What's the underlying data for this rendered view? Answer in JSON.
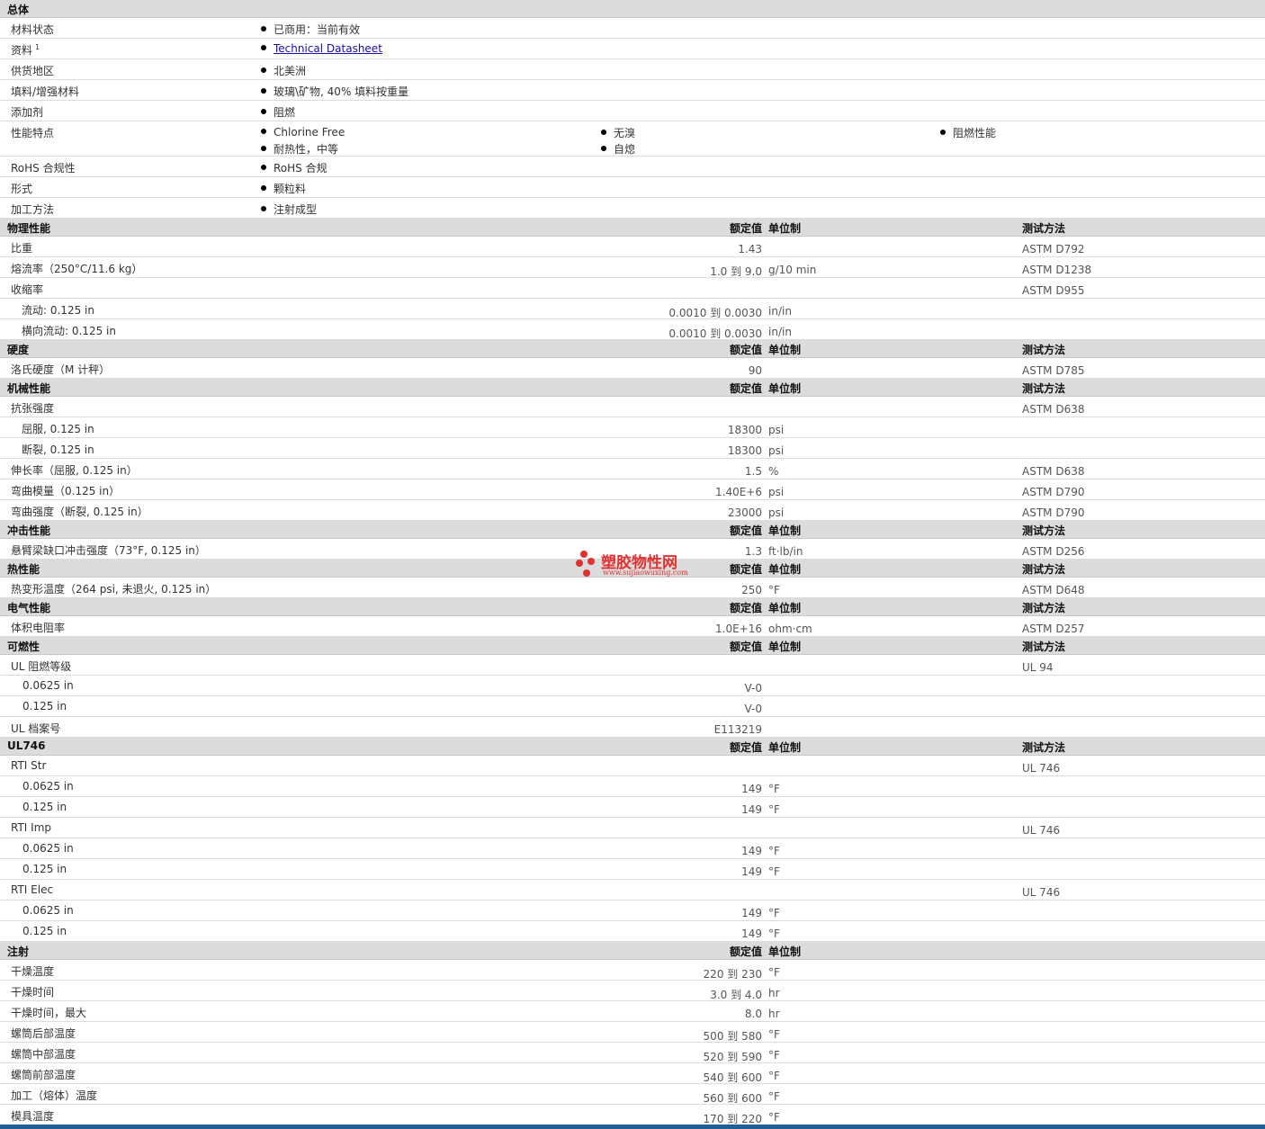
{
  "general": {
    "title": "总体",
    "rows": [
      {
        "label": "材料状态",
        "items": [
          "已商用：当前有效"
        ]
      },
      {
        "label": "资料",
        "sup": "1",
        "items": [
          "Technical Datasheet"
        ],
        "link": true
      },
      {
        "label": "供货地区",
        "items": [
          "北美洲"
        ]
      },
      {
        "label": "填料/增强材料",
        "items": [
          "玻璃\\矿物, 40% 填料按重量"
        ]
      },
      {
        "label": "添加剂",
        "items": [
          "阻燃"
        ]
      },
      {
        "label": "性能特点",
        "items": [
          "Chlorine Free",
          "无溴",
          "阻燃性能",
          "耐热性，中等",
          "自熄"
        ]
      },
      {
        "label": "RoHS 合规性",
        "items": [
          "RoHS 合规"
        ]
      },
      {
        "label": "形式",
        "items": [
          "颗粒料"
        ]
      },
      {
        "label": "加工方法",
        "items": [
          "注射成型"
        ]
      }
    ]
  },
  "columns": {
    "nominal": "额定值",
    "unit": "单位制",
    "test": "测试方法"
  },
  "sections": [
    {
      "title": "物理性能",
      "test_header": true,
      "rows": [
        {
          "label": "比重",
          "value": "1.43",
          "unit": "",
          "test": "ASTM D792"
        },
        {
          "label": "熔流率（250°C/11.6 kg）",
          "value": "1.0 到  9.0",
          "unit": "g/10 min",
          "test": "ASTM D1238"
        },
        {
          "label": "收缩率",
          "value": "",
          "unit": "",
          "test": "ASTM D955"
        },
        {
          "label": "流动: 0.125 in",
          "indent": 1,
          "value": "0.0010 到  0.0030",
          "unit": "in/in",
          "test": ""
        },
        {
          "label": "横向流动: 0.125 in",
          "indent": 1,
          "value": "0.0010 到  0.0030",
          "unit": "in/in",
          "test": ""
        }
      ]
    },
    {
      "title": "硬度",
      "test_header": true,
      "rows": [
        {
          "label": "洛氏硬度（M 计秤）",
          "value": "90",
          "unit": "",
          "test": "ASTM D785"
        }
      ]
    },
    {
      "title": "机械性能",
      "test_header": true,
      "rows": [
        {
          "label": "抗张强度",
          "value": "",
          "unit": "",
          "test": "ASTM D638"
        },
        {
          "label": "屈服, 0.125 in",
          "indent": 1,
          "value": "18300",
          "unit": "psi",
          "test": ""
        },
        {
          "label": "断裂, 0.125 in",
          "indent": 1,
          "value": "18300",
          "unit": "psi",
          "test": ""
        },
        {
          "label": "伸长率（屈服, 0.125 in）",
          "value": "1.5",
          "unit": "%",
          "test": "ASTM D638"
        },
        {
          "label": "弯曲模量（0.125 in）",
          "value": "1.40E+6",
          "unit": "psi",
          "test": "ASTM D790"
        },
        {
          "label": "弯曲强度（断裂, 0.125 in）",
          "value": "23000",
          "unit": "psi",
          "test": "ASTM D790"
        }
      ]
    },
    {
      "title": "冲击性能",
      "test_header": true,
      "rows": [
        {
          "label": "悬臂梁缺口冲击强度（73°F, 0.125 in）",
          "value": "1.3",
          "unit": "ft·lb/in",
          "test": "ASTM D256"
        }
      ]
    },
    {
      "title": "热性能",
      "test_header": true,
      "rows": [
        {
          "label": "热变形温度（264 psi, 未退火, 0.125 in）",
          "value": "250",
          "unit": "°F",
          "test": "ASTM D648"
        }
      ]
    },
    {
      "title": "电气性能",
      "test_header": true,
      "rows": [
        {
          "label": "体积电阻率",
          "value": "1.0E+16",
          "unit": "ohm·cm",
          "test": "ASTM D257"
        }
      ]
    },
    {
      "title": "可燃性",
      "test_header": true,
      "rows": [
        {
          "label": "UL 阻燃等级",
          "value": "",
          "unit": "",
          "test": "UL 94"
        },
        {
          "label": "0.0625 in",
          "indent": 2,
          "value": "V-0",
          "unit": "",
          "test": ""
        },
        {
          "label": "0.125 in",
          "indent": 2,
          "value": "V-0",
          "unit": "",
          "test": ""
        },
        {
          "label": "UL 档案号",
          "value": "E113219",
          "unit": "",
          "test": ""
        }
      ]
    },
    {
      "title": "UL746",
      "test_header": true,
      "rows": [
        {
          "label": "RTI Str",
          "value": "",
          "unit": "",
          "test": "UL 746"
        },
        {
          "label": "0.0625 in",
          "indent": 2,
          "value": "149",
          "unit": "°F",
          "test": ""
        },
        {
          "label": "0.125 in",
          "indent": 2,
          "value": "149",
          "unit": "°F",
          "test": ""
        },
        {
          "label": "RTI Imp",
          "value": "",
          "unit": "",
          "test": "UL 746"
        },
        {
          "label": "0.0625 in",
          "indent": 2,
          "value": "149",
          "unit": "°F",
          "test": ""
        },
        {
          "label": "0.125 in",
          "indent": 2,
          "value": "149",
          "unit": "°F",
          "test": ""
        },
        {
          "label": "RTI Elec",
          "value": "",
          "unit": "",
          "test": "UL 746"
        },
        {
          "label": "0.0625 in",
          "indent": 2,
          "value": "149",
          "unit": "°F",
          "test": ""
        },
        {
          "label": "0.125 in",
          "indent": 2,
          "value": "149",
          "unit": "°F",
          "test": ""
        }
      ]
    },
    {
      "title": "注射",
      "test_header": false,
      "rows": [
        {
          "label": "干燥温度",
          "value": "220 到  230",
          "unit": "°F",
          "test": ""
        },
        {
          "label": "干燥时间",
          "value": "3.0 到  4.0",
          "unit": "hr",
          "test": ""
        },
        {
          "label": "干燥时间，最大",
          "value": "8.0",
          "unit": "hr",
          "test": ""
        },
        {
          "label": "螺筒后部温度",
          "value": "500 到  580",
          "unit": "°F",
          "test": ""
        },
        {
          "label": "螺筒中部温度",
          "value": "520 到  590",
          "unit": "°F",
          "test": ""
        },
        {
          "label": "螺筒前部温度",
          "value": "540 到  600",
          "unit": "°F",
          "test": ""
        },
        {
          "label": "加工（熔体）温度",
          "value": "560 到  600",
          "unit": "°F",
          "test": ""
        },
        {
          "label": "模具温度",
          "value": "170 到  220",
          "unit": "°F",
          "test": ""
        }
      ]
    }
  ],
  "watermark": {
    "title": "塑胶物性网",
    "url": "www.sujiaowuxing.com",
    "color": "#e03030"
  },
  "colors": {
    "header_bg": "#dcdcdc",
    "link": "#1a0dab",
    "bottom_bar": "#1f5f99"
  }
}
